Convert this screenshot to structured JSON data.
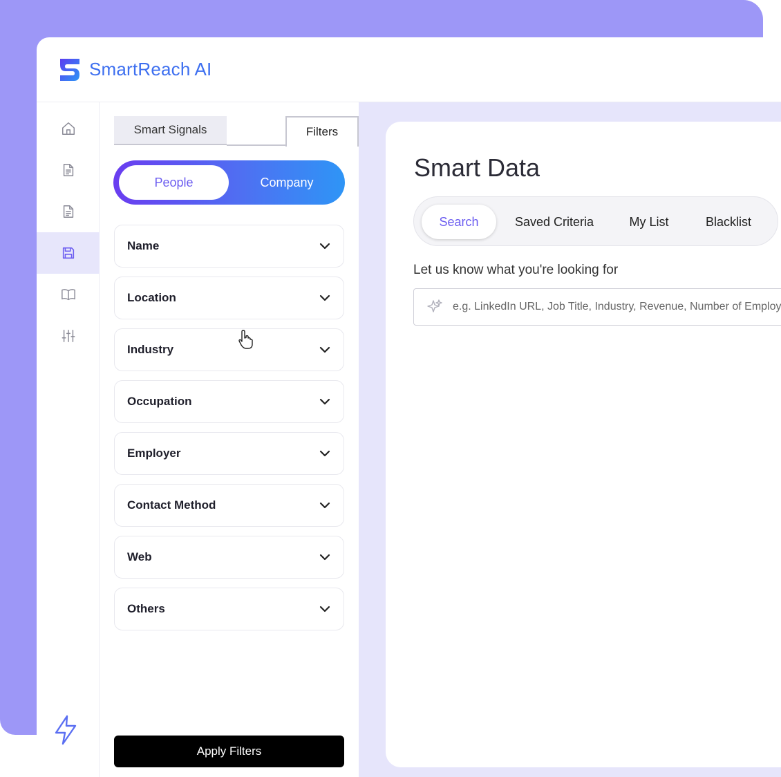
{
  "header": {
    "brand": "SmartReach AI"
  },
  "rail": {
    "items": [
      {
        "icon": "home-icon"
      },
      {
        "icon": "document-icon"
      },
      {
        "icon": "document-icon"
      },
      {
        "icon": "save-icon",
        "active": true
      },
      {
        "icon": "book-open-icon"
      },
      {
        "icon": "sliders-icon"
      }
    ],
    "bottom_icon": "lightning-icon"
  },
  "filters": {
    "tabs": [
      "Smart Signals",
      "Filters"
    ],
    "toggle": {
      "people": "People",
      "company": "Company",
      "selected": "People"
    },
    "items": [
      "Name",
      "Location",
      "Industry",
      "Occupation",
      "Employer",
      "Contact Method",
      "Web",
      "Others"
    ],
    "apply_label": "Apply Filters"
  },
  "main": {
    "title": "Smart Data",
    "tabs": [
      "Search",
      "Saved Criteria",
      "My List",
      "Blacklist"
    ],
    "active_tab": "Search",
    "prompt": "Let us know what you're looking for",
    "search_placeholder": "e.g. LinkedIn URL, Job Title, Industry, Revenue, Number of Employees"
  },
  "colors": {
    "accent": "#6b5cf0",
    "brand": "#3d6ff0",
    "backdrop": "#9d97f7",
    "active_rail": "#e7e6fb"
  }
}
